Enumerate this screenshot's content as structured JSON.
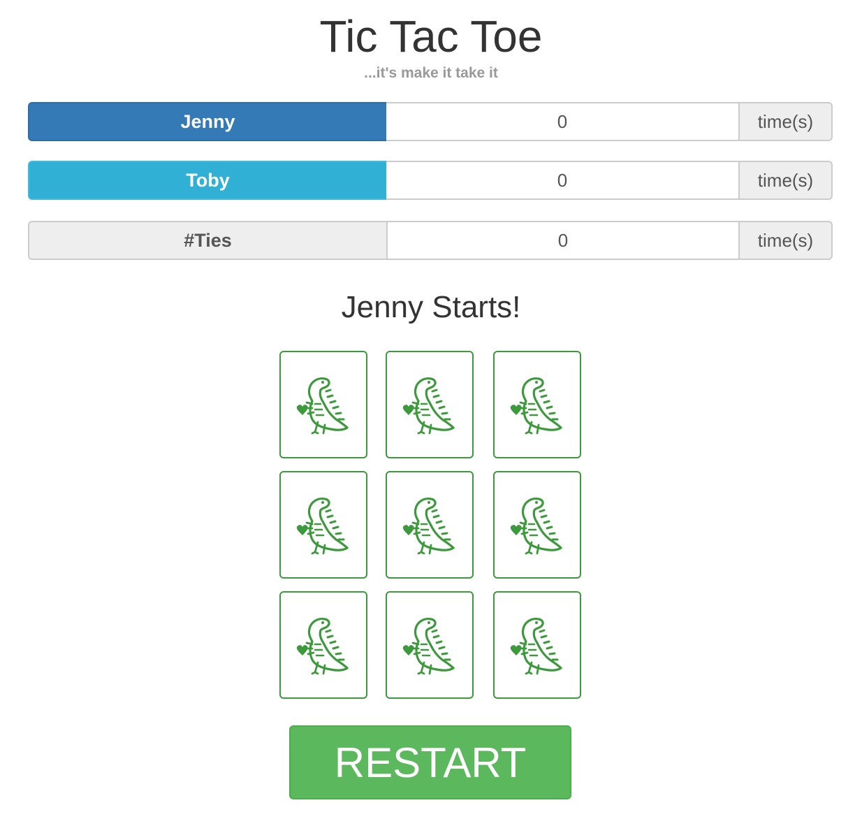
{
  "header": {
    "title": "Tic Tac Toe",
    "subtitle": "...it's make it take it"
  },
  "scoreboard": [
    {
      "name": "Jenny",
      "count": "0",
      "unit": "time(s)",
      "color": "#337ab7"
    },
    {
      "name": "Toby",
      "count": "0",
      "unit": "time(s)",
      "color": "#31b0d5"
    },
    {
      "name": "#Ties",
      "count": "0",
      "unit": "time(s)",
      "color": "#eeeeee"
    }
  ],
  "status": "Jenny Starts!",
  "board": {
    "cells": [
      "dino",
      "dino",
      "dino",
      "dino",
      "dino",
      "dino",
      "dino",
      "dino",
      "dino"
    ],
    "cell_icon": "dinosaur-heart-icon",
    "cell_color": "#3c9a3c"
  },
  "restart_label": "RESTART",
  "colors": {
    "restart": "#5cb85c",
    "player1": "#337ab7",
    "player2": "#31b0d5"
  }
}
